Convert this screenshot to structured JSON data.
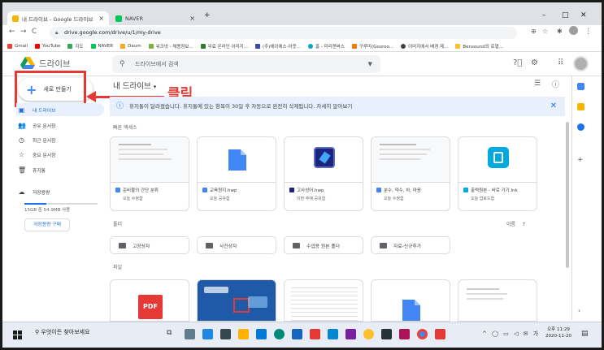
{
  "browser": {
    "tabs": [
      {
        "label": "내 드라이브 - Google 드라이브",
        "close": "×"
      },
      {
        "label": "NAVER",
        "close": "×"
      }
    ],
    "new_tab": "+",
    "window_controls": {
      "minimize": "–",
      "maximize": "□",
      "close": "✕"
    },
    "url": "drive.google.com/drive/u/1/my-drive",
    "bookmarks": [
      "Gmail",
      "YouTube",
      "지도",
      "NAVER",
      "Daum",
      "워크넷 - 채용정보...",
      "무료 온라인 이미지...",
      "(주)에이에스-아웃...",
      "홈 - 미리캔버스",
      "구루미(Gooroo...",
      "이미지에서 배경 제...",
      "Bensound의 로열..."
    ]
  },
  "drive": {
    "app_name": "드라이브",
    "search_placeholder": "드라이브에서 검색",
    "new_button": "새로 만들기",
    "annotation": "클릭",
    "sidebar": [
      {
        "label": "내 드라이브",
        "icon": "my-drive-icon",
        "glyph": "▣",
        "selected": true
      },
      {
        "label": "공유 문서함",
        "icon": "shared-icon",
        "glyph": "👥",
        "selected": false
      },
      {
        "label": "최근 문서함",
        "icon": "recent-icon",
        "glyph": "◷",
        "selected": false
      },
      {
        "label": "중요 문서함",
        "icon": "star-icon",
        "glyph": "☆",
        "selected": false
      },
      {
        "label": "휴지통",
        "icon": "trash-icon",
        "glyph": "🗑",
        "selected": false
      },
      {
        "label": "저장용량",
        "icon": "cloud-icon",
        "glyph": "☁",
        "selected": false
      }
    ],
    "storage_text": "15GB 중 54.9MB 사용",
    "buy_storage": "저장용량 구매",
    "page_title": "내 드라이브",
    "banner": "휴지통이 달라졌습니다. 휴지통에 있는 항목이 30일 후 자동으로 완전히 삭제됩니다. 자세히 알아보기",
    "quick_access_label": "빠른 액세스",
    "quick_access": [
      {
        "name": "준비물의 간단 분류",
        "sub": "오늘 수정함",
        "type": "doc"
      },
      {
        "name": "교육원지.hwp",
        "sub": "오늘 공유함",
        "type": "hwp"
      },
      {
        "name": "고사성어.hwp",
        "sub": "이번 주에 공유함",
        "type": "app"
      },
      {
        "name": "분수, 약수, 차, 마음",
        "sub": "오늘 수정함",
        "type": "doc"
      },
      {
        "name": "출력원본 - 바로 가기.lnk",
        "sub": "오늘 업로드함",
        "type": "lnk"
      }
    ],
    "folders_label": "폴더",
    "sort_label": "이름",
    "folders": [
      "고장상자",
      "사진상자",
      "수업용 원본 폴더",
      "자료-신규추가"
    ],
    "files_label": "파일",
    "files": [
      "PDF",
      "",
      "",
      "",
      ""
    ]
  },
  "taskbar": {
    "search": "우엇이든 찾아보세요",
    "time": "오후 11:29",
    "date": "2020-11-20"
  },
  "colors": {
    "red": "#e53935",
    "blue": "#1a73e8",
    "drive_yellow": "#f4b400",
    "drive_green": "#0f9d58"
  }
}
